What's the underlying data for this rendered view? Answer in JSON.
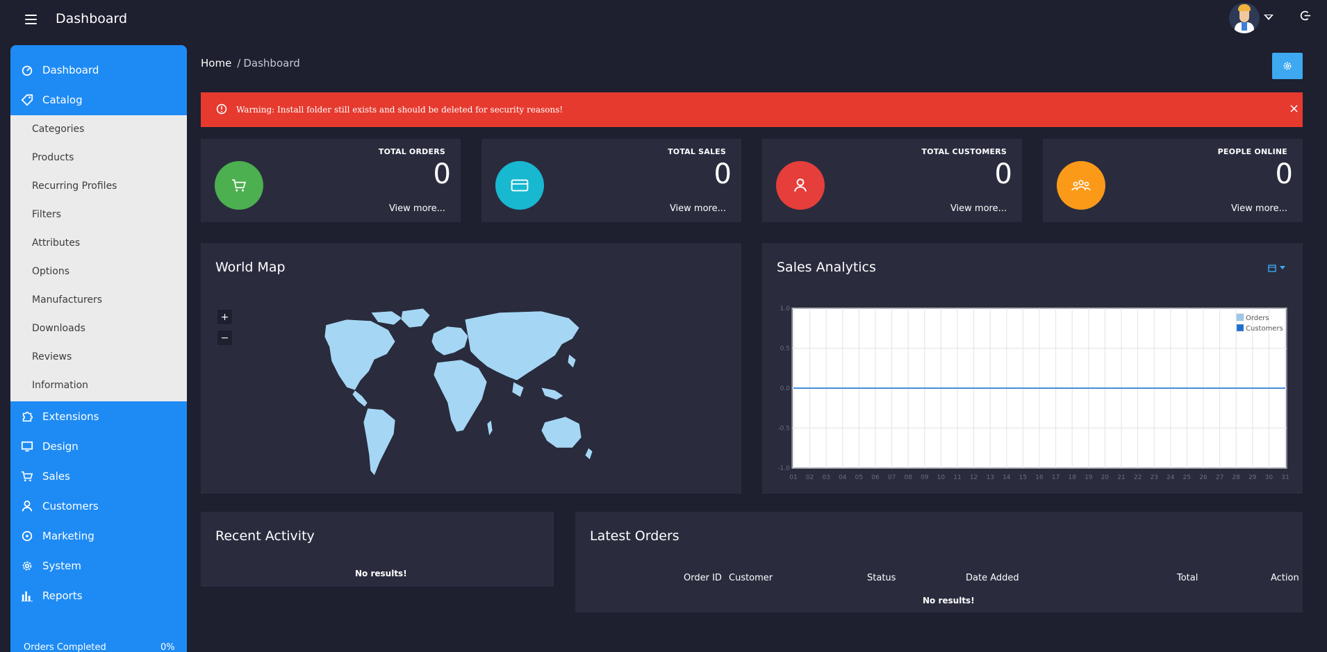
{
  "header": {
    "title": "Dashboard"
  },
  "sidebar": {
    "items": [
      {
        "label": "Dashboard"
      },
      {
        "label": "Catalog"
      },
      {
        "label": "Extensions"
      },
      {
        "label": "Design"
      },
      {
        "label": "Sales"
      },
      {
        "label": "Customers"
      },
      {
        "label": "Marketing"
      },
      {
        "label": "System"
      },
      {
        "label": "Reports"
      }
    ],
    "catalog_sub": [
      "Categories",
      "Products",
      "Recurring Profiles",
      "Filters",
      "Attributes",
      "Options",
      "Manufacturers",
      "Downloads",
      "Reviews",
      "Information"
    ],
    "progress_label": "Orders Completed",
    "progress_value": "0%"
  },
  "breadcrumb": {
    "home": "Home",
    "sep": "/",
    "current": "Dashboard"
  },
  "alert": {
    "text": "Warning: Install folder still exists and should be deleted for security reasons!",
    "close": "×"
  },
  "stats": [
    {
      "title": "TOTAL ORDERS",
      "value": "0",
      "more": "View more...",
      "color": "#4caf50"
    },
    {
      "title": "TOTAL SALES",
      "value": "0",
      "more": "View more...",
      "color": "#17b8d0"
    },
    {
      "title": "TOTAL CUSTOMERS",
      "value": "0",
      "more": "View more...",
      "color": "#e53e3b"
    },
    {
      "title": "PEOPLE ONLINE",
      "value": "0",
      "more": "View more...",
      "color": "#fb9a19"
    }
  ],
  "world_map": {
    "title": "World Map",
    "zoom_in": "+",
    "zoom_out": "−"
  },
  "sales_analytics": {
    "title": "Sales Analytics"
  },
  "chart_data": {
    "type": "line",
    "x": [
      "01",
      "02",
      "03",
      "04",
      "05",
      "06",
      "07",
      "08",
      "09",
      "10",
      "11",
      "12",
      "13",
      "14",
      "15",
      "16",
      "17",
      "18",
      "19",
      "20",
      "21",
      "22",
      "23",
      "24",
      "25",
      "26",
      "27",
      "28",
      "29",
      "30",
      "31"
    ],
    "yticks": [
      "1.0",
      "0.5",
      "0.0",
      "-0.5",
      "-1.0"
    ],
    "ylim": [
      -1.0,
      1.0
    ],
    "series": [
      {
        "name": "Orders",
        "color": "#9cc7ec",
        "values": [
          0,
          0,
          0,
          0,
          0,
          0,
          0,
          0,
          0,
          0,
          0,
          0,
          0,
          0,
          0,
          0,
          0,
          0,
          0,
          0,
          0,
          0,
          0,
          0,
          0,
          0,
          0,
          0,
          0,
          0,
          0
        ]
      },
      {
        "name": "Customers",
        "color": "#1a6fd1",
        "values": [
          0,
          0,
          0,
          0,
          0,
          0,
          0,
          0,
          0,
          0,
          0,
          0,
          0,
          0,
          0,
          0,
          0,
          0,
          0,
          0,
          0,
          0,
          0,
          0,
          0,
          0,
          0,
          0,
          0,
          0,
          0
        ]
      }
    ],
    "grid": true,
    "legend": "top-right"
  },
  "recent_activity": {
    "title": "Recent Activity",
    "empty": "No results!"
  },
  "latest_orders": {
    "title": "Latest Orders",
    "columns": [
      "Order ID",
      "Customer",
      "Status",
      "Date Added",
      "Total",
      "Action"
    ],
    "empty": "No results!"
  },
  "colors": {
    "accent": "#1e8bf4",
    "alert": "#e63a2f",
    "panel": "#2a2c3e",
    "background": "#1e1f2f",
    "map_land": "#a5d6f4"
  }
}
